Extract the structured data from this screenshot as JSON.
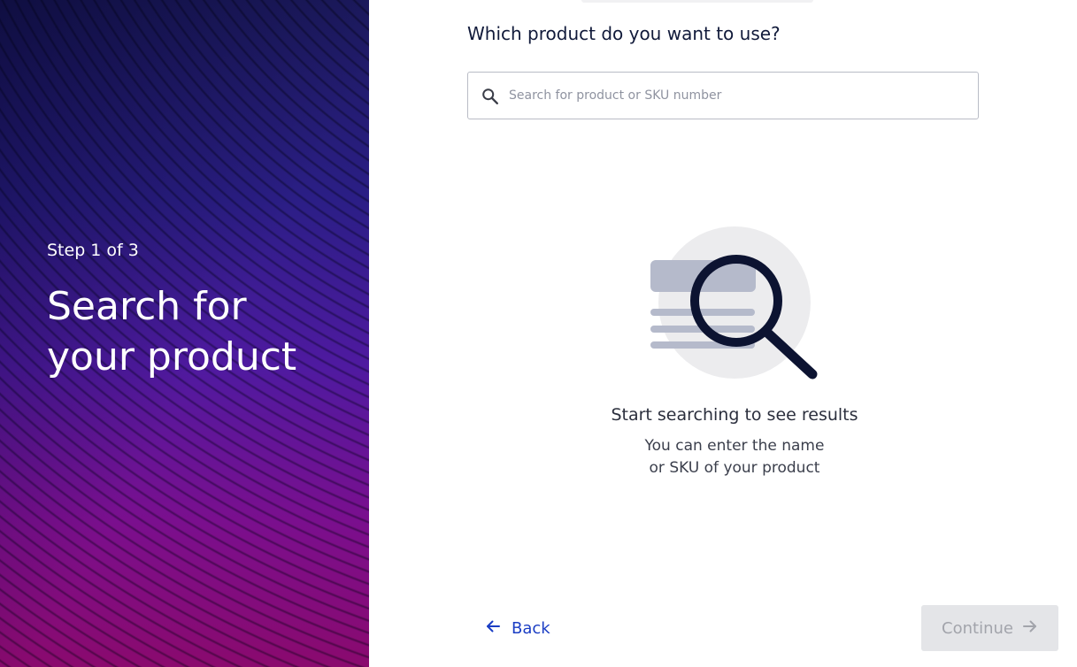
{
  "sidebar": {
    "step_label": "Step 1 of 3",
    "title": "Search for your product"
  },
  "main": {
    "question": "Which product do you want to use?",
    "search": {
      "placeholder": "Search for product or SKU number",
      "value": "",
      "icon": "search-icon"
    },
    "empty_state": {
      "icon": "magnifier-illustration",
      "title": "Start searching to see results",
      "description_line1": "You can enter the name",
      "description_line2": "or SKU of your product"
    }
  },
  "footer": {
    "back_label": "Back",
    "back_icon": "arrow-left-icon",
    "continue_label": "Continue",
    "continue_icon": "arrow-right-icon",
    "continue_disabled": true
  },
  "colors": {
    "accent": "#1a3dc4",
    "heading": "#111a3a",
    "panel_top": "#1c1a5e",
    "panel_bottom": "#8a0a6e",
    "disabled_bg": "#e4e5e8",
    "disabled_text": "#a2a4ab"
  }
}
